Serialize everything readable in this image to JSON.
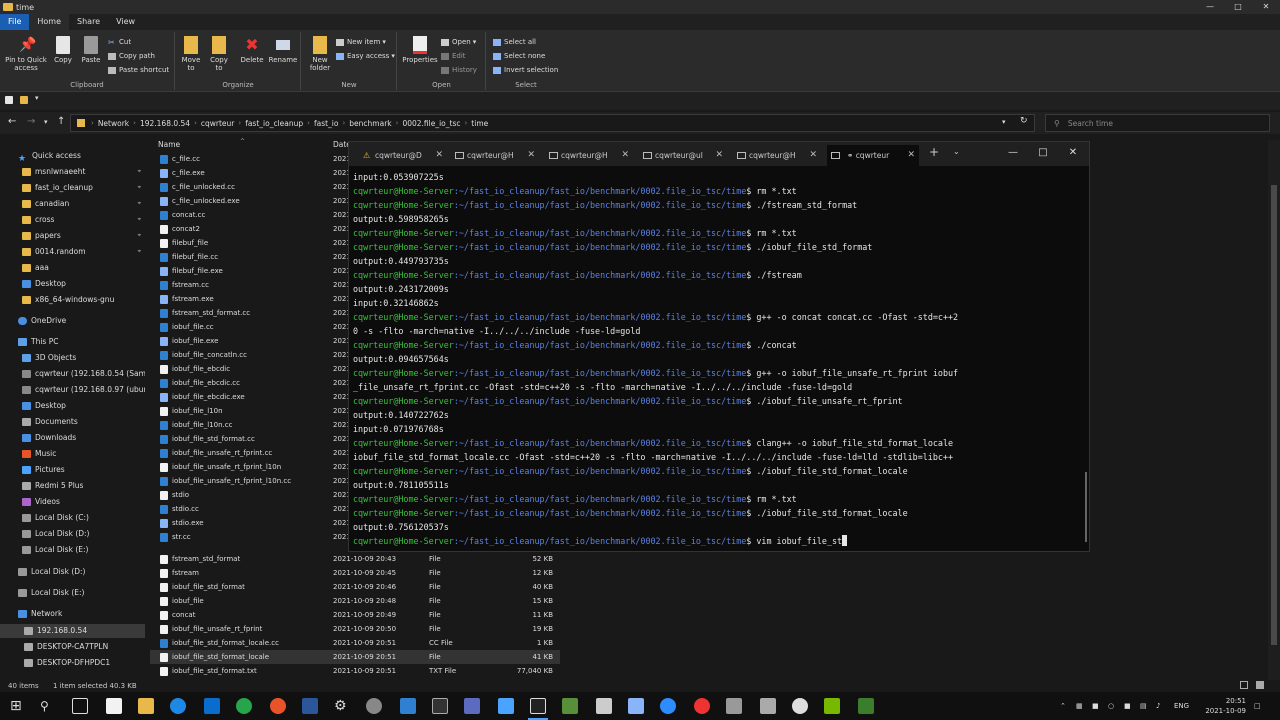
{
  "explorer": {
    "title": "time",
    "tabs": [
      "File",
      "Home",
      "Share",
      "View"
    ],
    "ribbon": {
      "clipboard": {
        "label": "Clipboard",
        "pin": "Pin to Quick access",
        "copy": "Copy",
        "paste": "Paste",
        "cut": "Cut",
        "copy_path": "Copy path",
        "paste_shortcut": "Paste shortcut"
      },
      "organize": {
        "label": "Organize",
        "move_to": "Move to",
        "copy_to": "Copy to",
        "delete": "Delete",
        "rename": "Rename"
      },
      "new": {
        "label": "New",
        "new_folder": "New folder",
        "new_item": "New item",
        "easy_access": "Easy access"
      },
      "open": {
        "label": "Open",
        "properties": "Properties",
        "open": "Open",
        "edit": "Edit",
        "history": "History"
      },
      "select": {
        "label": "Select",
        "select_all": "Select all",
        "select_none": "Select none",
        "invert": "Invert selection"
      }
    },
    "breadcrumb": [
      "Network",
      "192.168.0.54",
      "cqwrteur",
      "fast_io_cleanup",
      "fast_io",
      "benchmark",
      "0002.file_io_tsc",
      "time"
    ],
    "search_placeholder": "Search time",
    "nav": {
      "quick_access": "Quick access",
      "quick_items": [
        "msnlwnaeeht",
        "fast_io_cleanup",
        "canadian",
        "cross",
        "papers",
        "0014.random",
        "aaa",
        "Desktop",
        "x86_64-windows-gnu"
      ],
      "onedrive": "OneDrive",
      "this_pc": "This PC",
      "pc_items": [
        "3D Objects",
        "cqwrteur (192.168.0.54 (Samba",
        "cqwrteur (192.168.0.97 (ubuntu",
        "Desktop",
        "Documents",
        "Downloads",
        "Music",
        "Pictures",
        "Redmi 5 Plus",
        "Videos",
        "Local Disk (C:)",
        "Local Disk (D:)",
        "Local Disk (E:)"
      ],
      "drives": [
        "Local Disk (D:)",
        "Local Disk (E:)"
      ],
      "network": "Network",
      "network_items": [
        "192.168.0.54",
        "DESKTOP-CA7TPLN",
        "DESKTOP-DFHPDC1"
      ]
    },
    "columns": {
      "name": "Name",
      "date": "Date"
    },
    "files_top": [
      "c_file.cc",
      "c_file.exe",
      "c_file_unlocked.cc",
      "c_file_unlocked.exe",
      "concat.cc",
      "concat2",
      "filebuf_file",
      "filebuf_file.cc",
      "filebuf_file.exe",
      "fstream.cc",
      "fstream.exe",
      "fstream_std_format.cc",
      "iobuf_file.cc",
      "iobuf_file.exe",
      "iobuf_file_concatln.cc",
      "iobuf_file_ebcdic",
      "iobuf_file_ebcdic.cc",
      "iobuf_file_ebcdic.exe",
      "iobuf_file_l10n",
      "iobuf_file_l10n.cc",
      "iobuf_file_std_format.cc",
      "iobuf_file_unsafe_rt_fprint.cc",
      "iobuf_file_unsafe_rt_fprint_l10n",
      "iobuf_file_unsafe_rt_fprint_l10n.cc",
      "stdio",
      "stdio.cc",
      "stdio.exe",
      "str.cc"
    ],
    "date_stub": "2021",
    "files_bottom": [
      {
        "name": "fstream_std_format",
        "date": "2021-10-09 20:43",
        "type": "File",
        "size": "52 KB"
      },
      {
        "name": "fstream",
        "date": "2021-10-09 20:45",
        "type": "File",
        "size": "12 KB"
      },
      {
        "name": "iobuf_file_std_format",
        "date": "2021-10-09 20:46",
        "type": "File",
        "size": "40 KB"
      },
      {
        "name": "iobuf_file",
        "date": "2021-10-09 20:48",
        "type": "File",
        "size": "15 KB"
      },
      {
        "name": "concat",
        "date": "2021-10-09 20:49",
        "type": "File",
        "size": "11 KB"
      },
      {
        "name": "iobuf_file_unsafe_rt_fprint",
        "date": "2021-10-09 20:50",
        "type": "File",
        "size": "19 KB"
      },
      {
        "name": "iobuf_file_std_format_locale.cc",
        "date": "2021-10-09 20:51",
        "type": "CC File",
        "size": "1 KB"
      },
      {
        "name": "iobuf_file_std_format_locale",
        "date": "2021-10-09 20:51",
        "type": "File",
        "size": "41 KB"
      },
      {
        "name": "iobuf_file_std_format.txt",
        "date": "2021-10-09 20:51",
        "type": "TXT File",
        "size": "77,040 KB"
      }
    ],
    "status": {
      "items": "40 items",
      "selected": "1 item selected  40.3 KB"
    }
  },
  "terminal": {
    "tabs": [
      "cqwrteur@D",
      "cqwrteur@H",
      "cqwrteur@H",
      "cqwrteur@ul",
      "cqwrteur@H",
      "cqwrteur"
    ],
    "new_tab": "+",
    "prompt_user": "cqwrteur@Home-Server",
    "prompt_path": ":~/fast_io_cleanup/fast_io/benchmark/0002.file_io_tsc/time",
    "lines": [
      {
        "t": "out",
        "text": "input:0.053907225s"
      },
      {
        "t": "cmd",
        "text": "$ rm *.txt"
      },
      {
        "t": "cmd",
        "text": "$ ./fstream_std_format"
      },
      {
        "t": "out",
        "text": "output:0.598958265s"
      },
      {
        "t": "cmd",
        "text": "$ rm *.txt"
      },
      {
        "t": "cmd",
        "text": "$ ./iobuf_file_std_format"
      },
      {
        "t": "out",
        "text": "output:0.449793735s"
      },
      {
        "t": "cmd",
        "text": "$ ./fstream"
      },
      {
        "t": "out",
        "text": "output:0.243172009s"
      },
      {
        "t": "out",
        "text": "input:0.32146862s"
      },
      {
        "t": "cmd",
        "text": "$ g++ -o concat concat.cc -Ofast -std=c++2"
      },
      {
        "t": "out",
        "text": "0 -s -flto -march=native -I../../../include -fuse-ld=gold"
      },
      {
        "t": "cmd",
        "text": "$ ./concat"
      },
      {
        "t": "out",
        "text": "output:0.094657564s"
      },
      {
        "t": "cmd",
        "text": "$ g++ -o iobuf_file_unsafe_rt_fprint iobuf"
      },
      {
        "t": "out",
        "text": "_file_unsafe_rt_fprint.cc -Ofast -std=c++20 -s -flto -march=native -I../../../include -fuse-ld=gold"
      },
      {
        "t": "cmd",
        "text": "$ ./iobuf_file_unsafe_rt_fprint"
      },
      {
        "t": "out",
        "text": "output:0.140722762s"
      },
      {
        "t": "out",
        "text": "input:0.071976768s"
      },
      {
        "t": "cmd",
        "text": "$ clang++ -o iobuf_file_std_format_locale"
      },
      {
        "t": "out",
        "text": "iobuf_file_std_format_locale.cc -Ofast -std=c++20 -s -flto -march=native -I../../../include -fuse-ld=lld -stdlib=libc++"
      },
      {
        "t": "cmd",
        "text": "$ ./iobuf_file_std_format_locale"
      },
      {
        "t": "out",
        "text": "output:0.781105511s"
      },
      {
        "t": "cmd",
        "text": "$ rm *.txt"
      },
      {
        "t": "cmd",
        "text": "$ ./iobuf_file_std_format_locale"
      },
      {
        "t": "out",
        "text": "output:0.756120537s"
      },
      {
        "t": "cmd",
        "text": "$ vim iobuf_file_st"
      }
    ]
  },
  "taskbar": {
    "lang": "ENG",
    "time": "20:51",
    "date": "2021-10-09"
  },
  "colors": {
    "accent": "#1a5fb4",
    "prompt_user": "#39c23c",
    "prompt_path": "#5b82e6"
  }
}
